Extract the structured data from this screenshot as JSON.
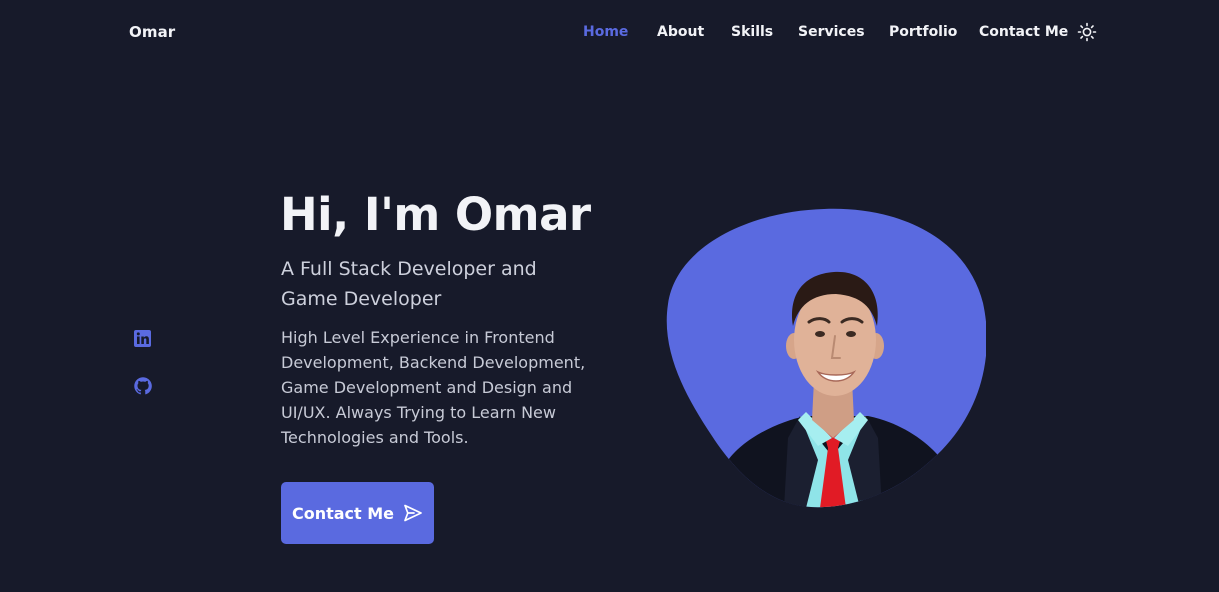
{
  "header": {
    "logo": "Omar",
    "nav": [
      {
        "label": "Home",
        "active": true
      },
      {
        "label": "About",
        "active": false
      },
      {
        "label": "Skills",
        "active": false
      },
      {
        "label": "Services",
        "active": false
      },
      {
        "label": "Portfolio",
        "active": false
      },
      {
        "label": "Contact Me",
        "active": false
      }
    ],
    "theme_toggle_icon": "sun-icon"
  },
  "social": [
    {
      "icon": "linkedin-icon"
    },
    {
      "icon": "github-icon"
    }
  ],
  "hero": {
    "title": "Hi, I'm Omar",
    "subtitle": "A Full Stack Developer and Game Developer",
    "description": "High Level Experience in Frontend Development, Backend Development, Game Development and Design and UI/UX. Always Trying to Learn New Technologies and Tools.",
    "cta_label": "Contact Me",
    "cta_icon": "send-icon"
  },
  "colors": {
    "background": "#171a2a",
    "accent": "#5a6ae0",
    "text": "#f2f3f7",
    "muted_text": "#c7cad6"
  }
}
